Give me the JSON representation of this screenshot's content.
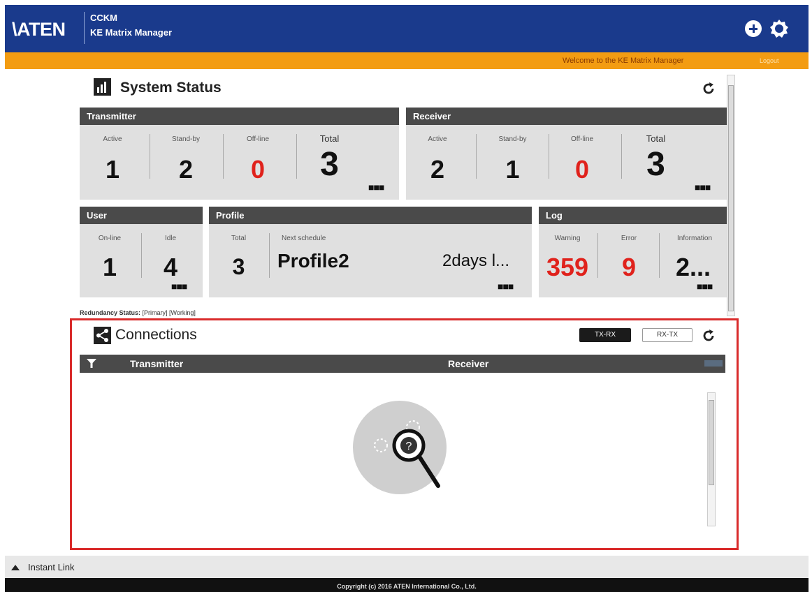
{
  "header": {
    "logo": "\\ATEN",
    "app_line1": "CCKM",
    "app_line2": "KE Matrix Manager"
  },
  "topbar": {
    "welcome": "Welcome to the KE Matrix Manager",
    "logout": "Logout"
  },
  "system_status": {
    "title": "System Status",
    "transmitter": {
      "header": "Transmitter",
      "active_label": "Active",
      "active": "1",
      "standby_label": "Stand-by",
      "standby": "2",
      "offline_label": "Off-line",
      "offline": "0",
      "total_label": "Total",
      "total": "3"
    },
    "receiver": {
      "header": "Receiver",
      "active_label": "Active",
      "active": "2",
      "standby_label": "Stand-by",
      "standby": "1",
      "offline_label": "Off-line",
      "offline": "0",
      "total_label": "Total",
      "total": "3"
    },
    "user": {
      "header": "User",
      "online_label": "On-line",
      "online": "1",
      "idle_label": "Idle",
      "idle": "4"
    },
    "profile": {
      "header": "Profile",
      "total_label": "Total",
      "total": "3",
      "next_label": "Next schedule",
      "next_name": "Profile2",
      "next_time": "2days l..."
    },
    "log": {
      "header": "Log",
      "warning_label": "Warning",
      "warning": "359",
      "error_label": "Error",
      "error": "9",
      "info_label": "Information",
      "info": "2..."
    },
    "more_glyph": "■■■",
    "redundancy_label": "Redundancy Status:",
    "redundancy_value": "[Primary] [Working]"
  },
  "connections": {
    "title": "Connections",
    "btn_txrx": "TX-RX",
    "btn_rxtx": "RX-TX",
    "col_transmitter": "Transmitter",
    "col_receiver": "Receiver"
  },
  "footer": {
    "instant_link": "Instant Link",
    "copyright": "Copyright (c) 2016 ATEN International Co., Ltd."
  },
  "colors": {
    "header_blue": "#1a3a8c",
    "orange": "#f39c12",
    "alert_red": "#e0221c",
    "card_gray": "#e0e0e0",
    "card_header": "#4a4a4a"
  }
}
